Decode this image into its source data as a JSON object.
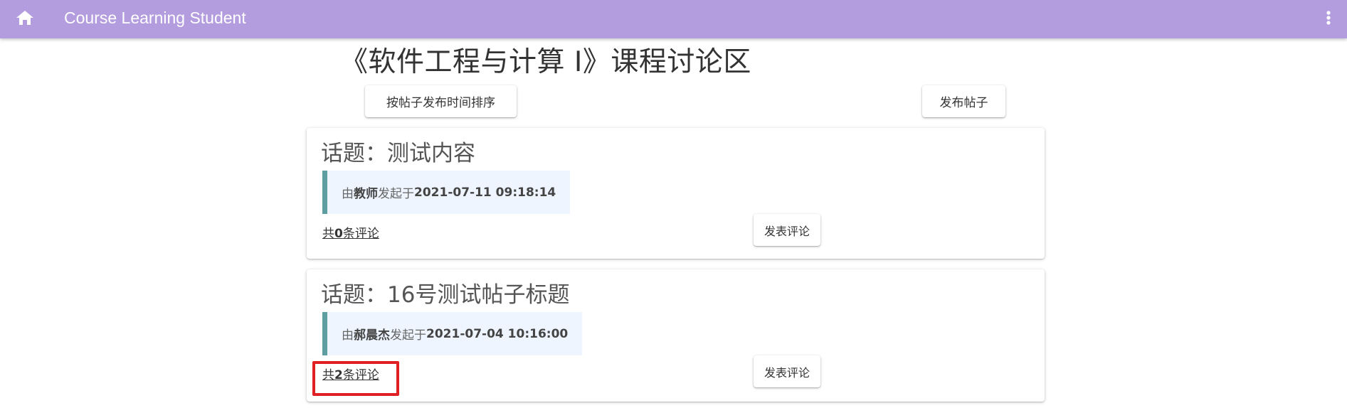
{
  "appbar": {
    "title": "Course Learning Student",
    "home_icon": "home-icon",
    "menu_icon": "more-vert-icon",
    "color": "#b39ddf"
  },
  "page": {
    "title": "《软件工程与计算 I》课程讨论区",
    "sort_button": "按帖子发布时间排序",
    "post_button": "发布帖子"
  },
  "posts": [
    {
      "topic": "话题：测试内容",
      "meta_prefix": "由",
      "author": "教师",
      "meta_mid": "发起于",
      "time": "2021-07-11 09:18:14",
      "comments_prefix": "共",
      "comments_count": "0",
      "comments_suffix": "条评论",
      "comment_button": "发表评论"
    },
    {
      "topic": "话题：16号测试帖子标题",
      "meta_prefix": "由",
      "author": "郝晨杰",
      "meta_mid": "发起于",
      "time": "2021-07-04 10:16:00",
      "comments_prefix": "共",
      "comments_count": "2",
      "comments_suffix": "条评论",
      "comment_button": "发表评论"
    }
  ],
  "colors": {
    "meta_border": "#5f9ea0",
    "meta_background": "#eef5ff",
    "highlight": "#e01f25"
  }
}
